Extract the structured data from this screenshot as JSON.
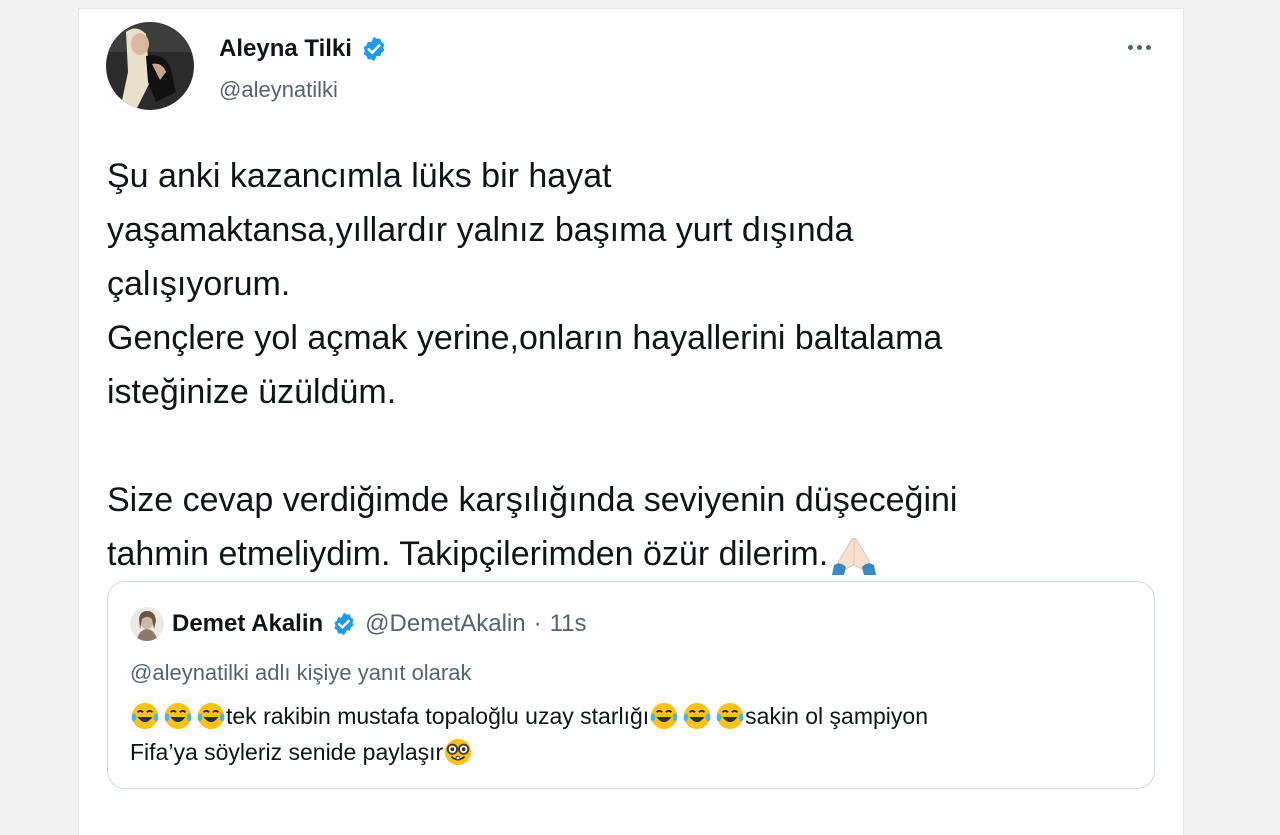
{
  "tweet": {
    "author_name": "Aleyna Tilki",
    "author_handle": "@aleynatilki",
    "verified": true,
    "text_lines": [
      "Şu anki kazancımla lüks bir hayat",
      "yaşamaktansa,yıllardır yalnız başıma yurt dışında",
      "çalışıyorum.",
      "Gençlere yol açmak yerine,onların hayallerini baltalama",
      "isteğinize üzüldüm.",
      "Size cevap verdiğimde karşılığında seviyenin düşeceğini",
      "tahmin etmeliydim. Takipçilerimden özür dilerim."
    ],
    "trailing_emoji": "folded-hands-emoji"
  },
  "quoted": {
    "author_name": "Demet Akalin",
    "author_handle": "@DemetAkalin",
    "separator": "·",
    "time": "11s",
    "reply_context": "@aleynatilki adlı kişiye yanıt olarak",
    "text_line1_part1": "tek rakibin mustafa topaloğlu uzay starlığı",
    "text_line1_part2": "sakin ol şampiyon",
    "text_line2": "Fifa’ya söyleriz senide paylaşır",
    "emojis": [
      "face-with-tears-of-joy-emoji",
      "nerd-face-emoji"
    ]
  },
  "colors": {
    "text": "#0f1419",
    "secondary": "#536471",
    "verified_blue": "#1d9bf0",
    "quote_border": "#cfd9de"
  }
}
